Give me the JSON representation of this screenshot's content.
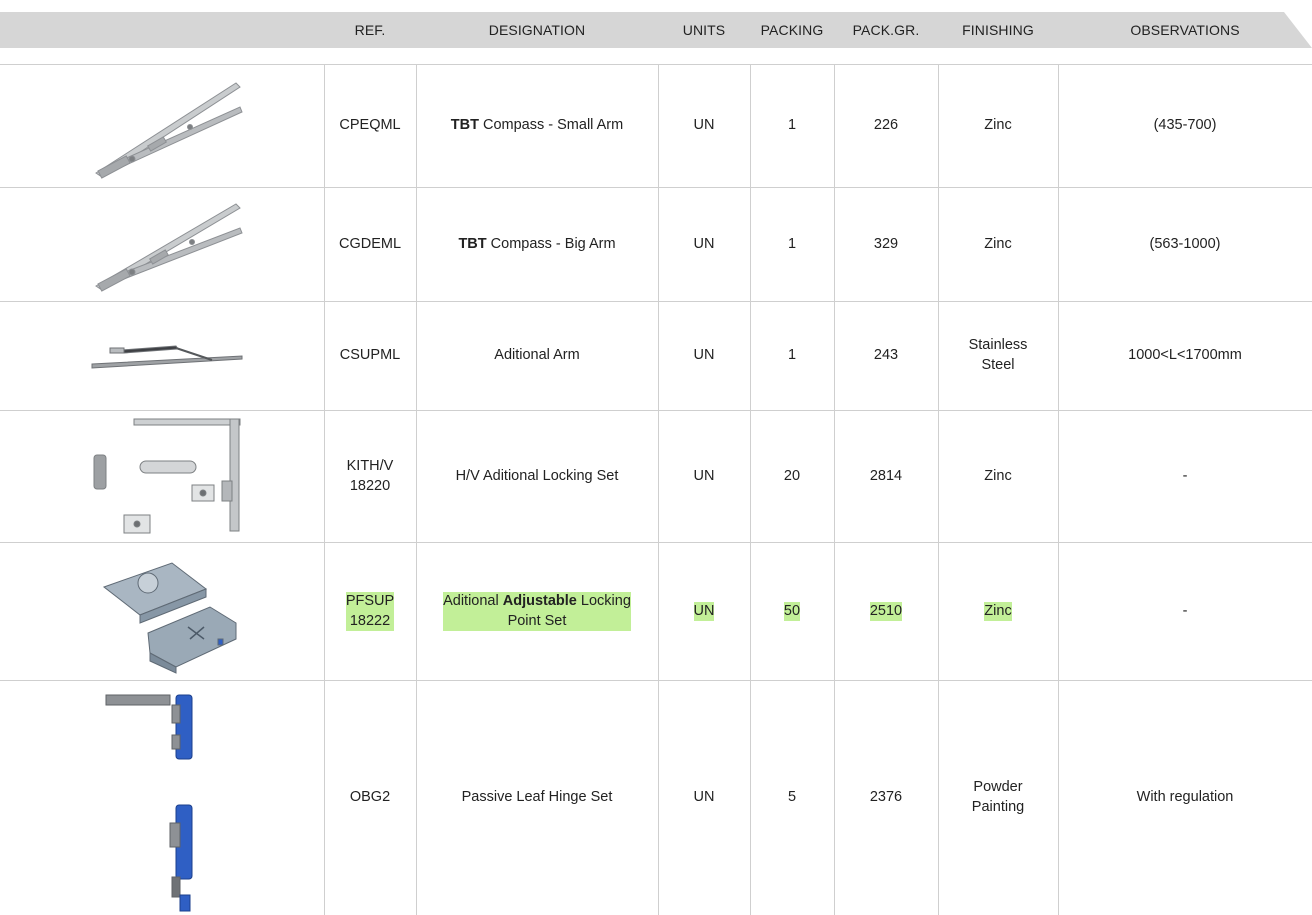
{
  "header": {
    "ref": "REF.",
    "designation": "DESIGNATION",
    "units": "UNITS",
    "packing": "PACKING",
    "pack_gr": "PACK.GR.",
    "finishing": "FINISHING",
    "observations": "OBSERVATIONS"
  },
  "rows": [
    {
      "image_icon": "compass-arm-small-icon",
      "ref": [
        "CPEQML"
      ],
      "designation": [
        {
          "text": "TBT",
          "bold": true
        },
        {
          "text": " Compass - Small Arm",
          "bold": false
        }
      ],
      "units": "UN",
      "packing": "1",
      "pack_gr": "226",
      "finishing": [
        "Zinc"
      ],
      "observations": "(435-700)",
      "highlighted": false
    },
    {
      "image_icon": "compass-arm-big-icon",
      "ref": [
        "CGDEML"
      ],
      "designation": [
        {
          "text": "TBT",
          "bold": true
        },
        {
          "text": " Compass - Big Arm",
          "bold": false
        }
      ],
      "units": "UN",
      "packing": "1",
      "pack_gr": "329",
      "finishing": [
        "Zinc"
      ],
      "observations": "(563-1000)",
      "highlighted": false
    },
    {
      "image_icon": "additional-arm-icon",
      "ref": [
        "CSUPML"
      ],
      "designation": [
        {
          "text": "Aditional Arm",
          "bold": false
        }
      ],
      "units": "UN",
      "packing": "1",
      "pack_gr": "243",
      "finishing": [
        "Stainless",
        "Steel"
      ],
      "observations": "1000<L<1700mm",
      "highlighted": false
    },
    {
      "image_icon": "locking-set-icon",
      "ref": [
        "KITH/V",
        "18220"
      ],
      "designation": [
        {
          "text": "H/V Aditional Locking Set",
          "bold": false
        }
      ],
      "units": "UN",
      "packing": "20",
      "pack_gr": "2814",
      "finishing": [
        "Zinc"
      ],
      "observations": "-",
      "highlighted": false
    },
    {
      "image_icon": "locking-point-set-icon",
      "ref": [
        "PFSUP",
        "18222"
      ],
      "designation": [
        {
          "text": "Aditional ",
          "bold": false
        },
        {
          "text": "Adjustable",
          "bold": true
        },
        {
          "text": " Locking",
          "bold": false
        },
        {
          "text": "\nPoint Set",
          "bold": false
        }
      ],
      "units": "UN",
      "packing": "50",
      "pack_gr": "2510",
      "finishing": [
        "Zinc"
      ],
      "observations": "-",
      "highlighted": true
    },
    {
      "image_icon": "passive-leaf-hinge-icon",
      "ref": [
        "OBG2"
      ],
      "designation": [
        {
          "text": "Passive Leaf Hinge Set",
          "bold": false
        }
      ],
      "units": "UN",
      "packing": "5",
      "pack_gr": "2376",
      "finishing": [
        "Powder",
        "Painting"
      ],
      "observations": "With regulation",
      "highlighted": false
    }
  ],
  "colors": {
    "header_bg": "#d6d6d6",
    "grid_line": "#cfcfcf",
    "highlight": "#c2ef98",
    "hinge_blue": "#2f5fc4",
    "metal": "#b9bcbf"
  }
}
